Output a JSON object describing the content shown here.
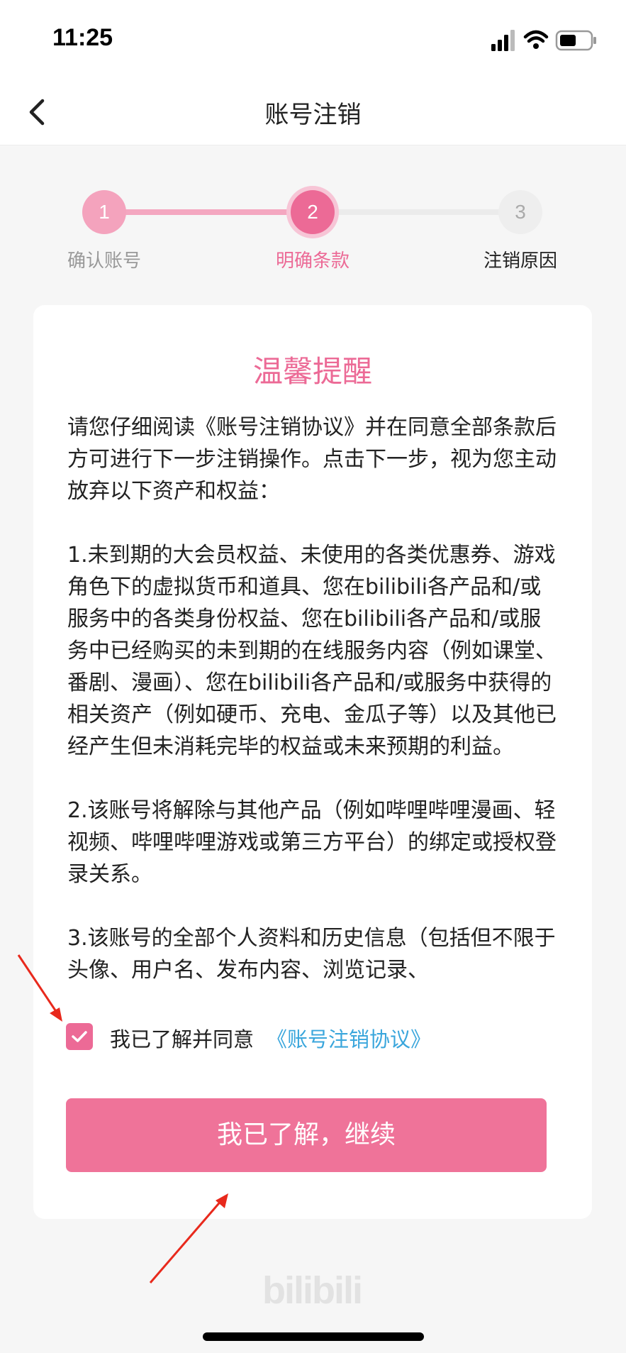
{
  "status_bar": {
    "time": "11:25"
  },
  "nav": {
    "title": "账号注销"
  },
  "stepper": {
    "steps": [
      {
        "number": "1",
        "label": "确认账号"
      },
      {
        "number": "2",
        "label": "明确条款"
      },
      {
        "number": "3",
        "label": "注销原因"
      }
    ],
    "current": 2
  },
  "card": {
    "title": "温馨提醒",
    "paragraphs": [
      "请您仔细阅读《账号注销协议》并在同意全部条款后方可进行下一步注销操作。点击下一步，视为您主动放弃以下资产和权益：",
      "1.未到期的大会员权益、未使用的各类优惠券、游戏角色下的虚拟货币和道具、您在bilibili各产品和/或服务中的各类身份权益、您在bilibili各产品和/或服务中已经购买的未到期的在线服务内容（例如课堂、番剧、漫画）、您在bilibili各产品和/或服务中获得的相关资产（例如硬币、充电、金瓜子等）以及其他已经产生但未消耗完毕的权益或未来预期的利益。",
      "2.该账号将解除与其他产品（例如哔哩哔哩漫画、轻视频、哔哩哔哩游戏或第三方平台）的绑定或授权登录关系。",
      "3.该账号的全部个人资料和历史信息（包括但不限于头像、用户名、发布内容、浏览记录、"
    ],
    "agree_checked": true,
    "agree_label": "我已了解并同意",
    "agree_link": "《账号注销协议》",
    "continue_label": "我已了解，继续"
  },
  "footer": {
    "logo_text": "bilibili"
  },
  "colors": {
    "accent": "#ec6a96",
    "link": "#3aa6dc",
    "button": "#ef7399"
  }
}
